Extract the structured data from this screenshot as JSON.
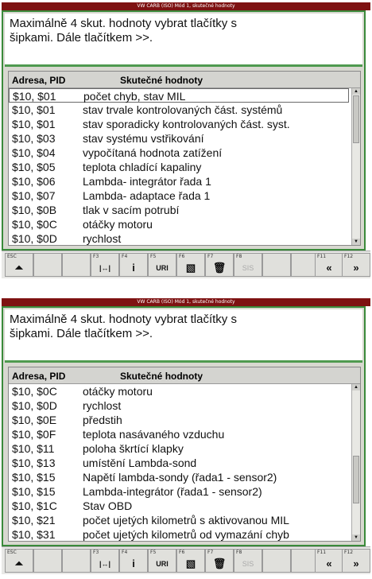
{
  "screens": [
    {
      "title": "VW CARB (ISO) Mód 1, skutečné hodnoty",
      "message_line1": "Maximálně 4 skut. hodnoty vybrat tlačítky s",
      "message_line2": "šipkami. Dále tlačítkem >>.",
      "header": {
        "col1": "Adresa, PID",
        "col2": "Skutečné hodnoty"
      },
      "rows": [
        {
          "addr": "$10, $01",
          "name": "počet chyb, stav MIL"
        },
        {
          "addr": "$10, $01",
          "name": "stav trvale kontrolovaných část. systémů"
        },
        {
          "addr": "$10, $01",
          "name": "stav sporadicky kontrolovaných část. syst."
        },
        {
          "addr": "$10, $03",
          "name": "stav systému vstřikování"
        },
        {
          "addr": "$10, $04",
          "name": "vypočítaná hodnota zatížení"
        },
        {
          "addr": "$10, $05",
          "name": "teplota chladící kapaliny"
        },
        {
          "addr": "$10, $06",
          "name": "Lambda- integrátor řada 1"
        },
        {
          "addr": "$10, $07",
          "name": "Lambda- adaptace řada 1"
        },
        {
          "addr": "$10, $0B",
          "name": "tlak v sacím potrubí"
        },
        {
          "addr": "$10, $0C",
          "name": "otáčky motoru"
        },
        {
          "addr": "$10, $0D",
          "name": "rychlost"
        }
      ]
    },
    {
      "title": "VW CARB (ISO) Mód 1, skutečné hodnoty",
      "message_line1": "Maximálně 4 skut. hodnoty vybrat tlačítky s",
      "message_line2": "šipkami. Dále tlačítkem >>.",
      "header": {
        "col1": "Adresa, PID",
        "col2": "Skutečné hodnoty"
      },
      "rows": [
        {
          "addr": "$10, $0C",
          "name": "otáčky motoru"
        },
        {
          "addr": "$10, $0D",
          "name": "rychlost"
        },
        {
          "addr": "$10, $0E",
          "name": "předstih"
        },
        {
          "addr": "$10, $0F",
          "name": "teplota nasávaného vzduchu"
        },
        {
          "addr": "$10, $11",
          "name": "poloha škrtící klapky"
        },
        {
          "addr": "$10, $13",
          "name": "umístění Lambda-sond"
        },
        {
          "addr": "$10, $15",
          "name": "Napětí lambda-sondy (řada1 - sensor2)"
        },
        {
          "addr": "$10, $15",
          "name": "Lambda-integrátor (řada1 - sensor2)"
        },
        {
          "addr": "$10, $1C",
          "name": "Stav OBD"
        },
        {
          "addr": "$10, $21",
          "name": "počet ujetých kilometrů s aktivovanou MIL"
        },
        {
          "addr": "$10, $31",
          "name": "počet ujetých kilometrů od vymazání chyb"
        }
      ]
    }
  ],
  "toolbar": {
    "keys": [
      {
        "fkey": "ESC",
        "icon": "⏶",
        "name": "esc-up"
      },
      {
        "fkey": "",
        "icon": "",
        "name": "blank-1"
      },
      {
        "fkey": "",
        "icon": "",
        "name": "blank-2"
      },
      {
        "fkey": "F3",
        "icon": "|↔|",
        "name": "f3-range"
      },
      {
        "fkey": "F4",
        "icon": "i",
        "name": "f4-info"
      },
      {
        "fkey": "F5",
        "icon": "URI",
        "name": "f5-uri"
      },
      {
        "fkey": "F6",
        "icon": "▧",
        "name": "f6-graph"
      },
      {
        "fkey": "F7",
        "icon": "🗑",
        "name": "f7-delete"
      },
      {
        "fkey": "F8",
        "icon": "SIS",
        "name": "f8-sis"
      },
      {
        "fkey": "",
        "icon": "",
        "name": "blank-3"
      },
      {
        "fkey": "",
        "icon": "",
        "name": "blank-4"
      },
      {
        "fkey": "F11",
        "icon": "«",
        "name": "f11-back"
      },
      {
        "fkey": "F12",
        "icon": "»",
        "name": "f12-forward"
      }
    ]
  }
}
